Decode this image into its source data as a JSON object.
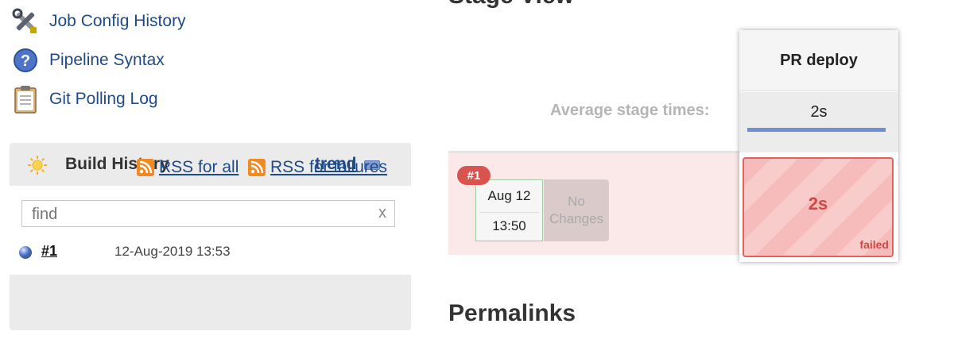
{
  "tasks": [
    {
      "label": "Job Config History",
      "icon": "tools-icon"
    },
    {
      "label": "Pipeline Syntax",
      "icon": "help-icon"
    },
    {
      "label": "Git Polling Log",
      "icon": "clipboard-icon"
    }
  ],
  "build_history": {
    "title": "Build History",
    "trend_label": "trend",
    "search_placeholder": "find",
    "clear_label": "x",
    "builds": [
      {
        "number": "#1",
        "date": "12-Aug-2019 13:53",
        "status_color": "#4a6fc0"
      }
    ],
    "rss_all_label": "RSS for all",
    "rss_failures_label": "RSS for failures"
  },
  "stage_view": {
    "title": "Stage View",
    "average_label": "Average stage times:",
    "stages": [
      {
        "name": "PR deploy",
        "average": "2s"
      }
    ],
    "runs": [
      {
        "badge": "#1",
        "date": "Aug 12",
        "time": "13:50",
        "changes": "No Changes",
        "cells": [
          {
            "duration": "2s",
            "status": "failed"
          }
        ]
      }
    ]
  },
  "permalinks_title": "Permalinks",
  "colors": {
    "link": "#204a87",
    "failed": "#d9534f",
    "average_bar": "#6f8fd3"
  }
}
